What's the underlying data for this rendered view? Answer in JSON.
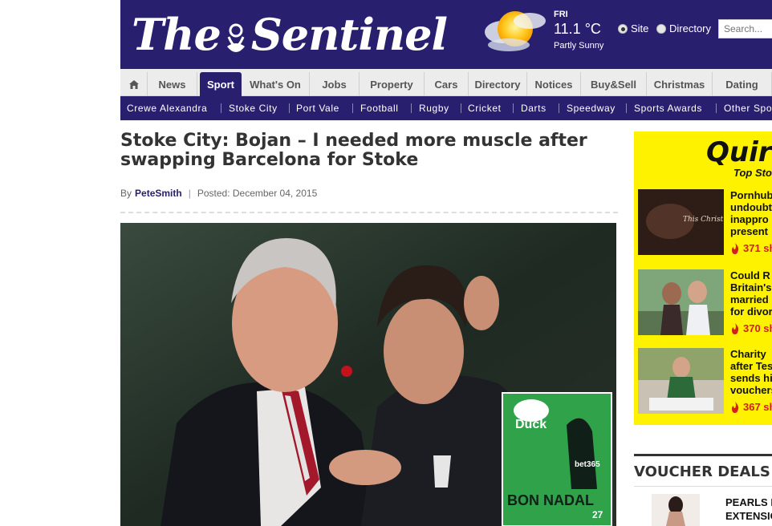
{
  "masthead": {
    "logo_text_1": "The",
    "logo_text_2": "Sentinel",
    "weather": {
      "day": "FRI",
      "temp": "11.1 °C",
      "desc": "Partly Sunny",
      "icon": "partly-sunny-icon"
    },
    "search_scope": [
      {
        "label": "Site",
        "selected": true
      },
      {
        "label": "Directory",
        "selected": false
      }
    ],
    "search_placeholder": "Search..."
  },
  "main_nav": [
    {
      "label": "",
      "icon": "home-icon"
    },
    {
      "label": "News"
    },
    {
      "label": "Sport",
      "active": true
    },
    {
      "label": "What's On"
    },
    {
      "label": "Jobs"
    },
    {
      "label": "Property"
    },
    {
      "label": "Cars"
    },
    {
      "label": "Directory"
    },
    {
      "label": "Notices"
    },
    {
      "label": "Buy&Sell"
    },
    {
      "label": "Christmas"
    },
    {
      "label": "Dating"
    }
  ],
  "sub_nav": [
    "Crewe Alexandra",
    "Stoke City",
    "Port Vale",
    "Football",
    "Rugby",
    "Cricket",
    "Darts",
    "Speedway",
    "Sports Awards",
    "Other Spo"
  ],
  "article": {
    "headline": "Stoke City: Bojan – I needed more muscle after swapping Barcelona for Stoke",
    "byline_prefix": "By",
    "author": "PeteSmith",
    "posted": "Posted: December 04, 2015",
    "magazine": {
      "title": "Duck",
      "cover_text": "BON NADAL",
      "sponsor": "bet365",
      "number": "27"
    }
  },
  "sidebar": {
    "quirky_logo": "Quirk",
    "quirky_sub": "Top Sto",
    "stories": [
      {
        "title_lines": [
          "Pornhub",
          "undoubt",
          "inappro",
          "present"
        ],
        "shares": "371 sh",
        "thumb_caption": "This Christ give the most lo"
      },
      {
        "title_lines": [
          "Could R",
          "Britain's",
          "married",
          "for divor"
        ],
        "shares": "370 sh"
      },
      {
        "title_lines": [
          "Charity",
          "after Tes",
          "sends hi",
          "vouchers"
        ],
        "shares": "367 sh"
      }
    ],
    "voucher_title": "VOUCHER DEALS",
    "voucher_item": [
      "PEARLS H",
      "EXTENSIO"
    ]
  },
  "colors": {
    "brand": "#28206e",
    "quirky_bg": "#fff200",
    "share_red": "#d22020"
  }
}
